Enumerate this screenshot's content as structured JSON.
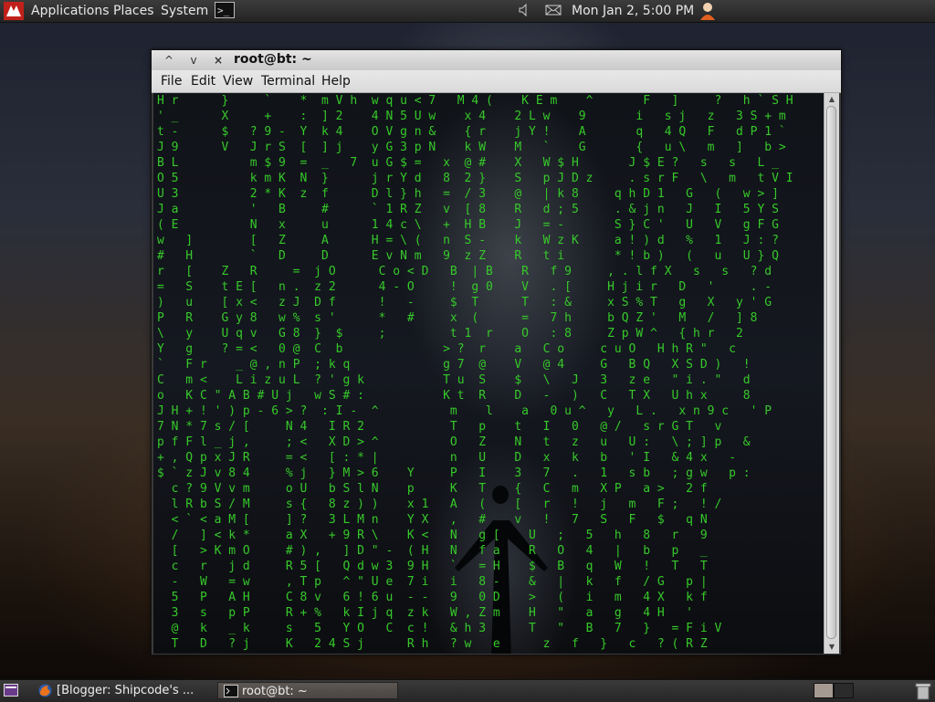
{
  "top_panel": {
    "menus": [
      "Applications",
      "Places",
      "System"
    ],
    "launcher_glyph": ">_",
    "clock": "Mon Jan  2,  5:00 PM",
    "icons": [
      "backtrack-logo-icon",
      "terminal-launcher-icon",
      "volume-icon",
      "mail-icon",
      "user-status-icon"
    ]
  },
  "window": {
    "title": "root@bt: ~",
    "controls": [
      "^",
      "v",
      "×"
    ],
    "menu": [
      "File",
      "Edit",
      "View",
      "Terminal",
      "Help"
    ],
    "matrix_lines": [
      "H r      }     `    *  m V h  w q u < 7   M 4 (    K E m    ^       F   ]     ?   h ` S H",
      "' _      X     +    :  ] 2    4 N 5 U w    x 4    2 L w    9       i   s j   z   3 S + m",
      "t -      $   ? 9 -  Y  k 4    O V g n &    { r    j Y !    A       q   4 Q   F   d P 1 `",
      "J 9      V   J r S  [  ] j    y G 3 p N    k W    M   `    G       {   u \\   m   ]   b >",
      "B L          m $ 9  =  _   7  u G $ =   x  @ #    X   W $ H       J $ E ?   s   s   L _",
      "O 5          k m K  N  }      j r Y d   8  2 }    S   p J D z     . s r F   \\   m   t V I",
      "U 3          2 * K  z  f      D l } h   =  / 3    @   | k 8     q h D 1   G   (   w > ]",
      "J a          '   B     #      ` 1 R Z   v  [ 8    R   d ; 5     . & j n   J   I   5 Y S",
      "( E          N   x     u      1 4 c \\   +  H B    J   = -       S } C '   U   V   g F G",
      "w   ]        [   Z     A      H = \\ (   n  S -    k   W z K     a ! ) d   %   1   J : ?",
      "#   H        `   D     D      E v N m   9  z Z    R   t i       * ! b )   (   u   U } Q",
      "r   [    Z   R     =  j O      C o < D   B  | B    R   f 9     , . l f X   s   s   ? d",
      "=   S    t E [   n .  z 2      4 - O     !  g 0    V   . [     H j i r   D   '     . -",
      ")   u    [ x <   z J  D f      !   -     $  T      T   : &     x S % T   g   X   y ' G",
      "P   R    G y 8   w %  s '      *   #     x  (      =   7 h     b Q Z '   M   /   ] 8",
      "\\   y    U q v   G 8  }  $     ;         t 1  r    O   : 8     Z p W ^   { h r   2",
      "Y   g    ? = <   0 @  C  b              > ?  r    a   C o     c u O   H h R \"   c",
      "`   F r    _ @ , n P  ; k q             g 7  @    V   @ 4     G   B Q   X S D )   !",
      "C   m <    L i z u L  ? ' g k           T u  S    $   \\   J   3   z e   \" i . \"   d",
      "o   K C \" A B # U j   w S # :           K t  R    D   -   )   C   T X   U h x     8",
      "J H + ! ' ) p - 6 > ?  : I -  ^          m    l    a   0 u ^   y   L .   x n 9 c   ' P",
      "7 N * 7 s / [     N 4   I R 2            T   p    t   I   0   @ /   s r G T   v",
      "p f F l _ j ,     ; <   X D > ^          O   Z    N   t   z   u   U :   \\ ; ] p   &",
      "+ , Q p x J R     = <   [ : * |          n   U    D   x   k   b   ' I   & 4 x   -",
      "$ ` z J v 8 4     % j   } M > 6    Y     P   I    3   7   .   1   s b   ; g w   p :",
      "  c ? 9 V v m     o U   b S l N    p     K   T    {   C   m   X P   a >   2 f",
      "  l R b S / M     s {   8 z ) )    x 1   A   (    [   r   !   j   m   F ;   ! /",
      "  < ` < a M [     ] ?   3 L M n    Y X   ,   #    v   !   7   S   F   $   q N",
      "  /   ] < k *     a X   + 9 R \\    K <   N   g [    U   ;   5   h   8   r   9",
      "  [   > K m O     # ) ,   ] D \" -  ( H   N   f a    R   O   4   |   b   p   _",
      "  c   r   j d     R 5 [   Q d w 3  9 H   `   = H    $   B   q   W   !   T   T",
      "  -   W   = w     , T p   ^ \" U e  7 i   i   8 -    &   |   k   f   / G   p |",
      "  5   P   A H     C 8 v   6 ! 6 u  - -   9   0 D    >   (   i   m   4 X   k f",
      "  3   s   p P     R + %   k I j q  z k   W , Z m    H   \"   a   g   4 H   '",
      "  @   k   _ k     s   5   Y O   C  c !   & h 3      T   \"   B   7   }   = F i V",
      "  T   D   ? j     K   2 4 S j      R h   ? w   e      z   f   }   c   ? ( R Z"
    ]
  },
  "taskbar": {
    "tasks": [
      "[Blogger: Shipcode's ...",
      "root@bt: ~"
    ]
  }
}
